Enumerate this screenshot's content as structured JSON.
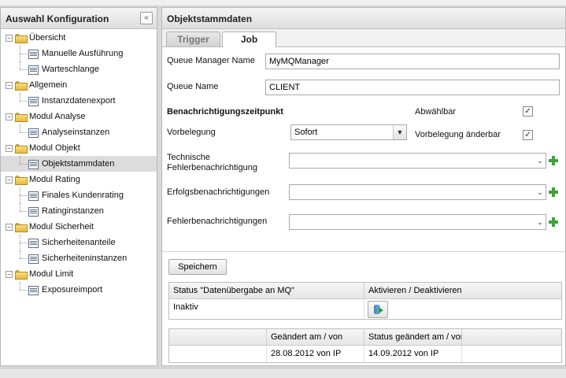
{
  "left_panel": {
    "title": "Auswahl Konfiguration",
    "collapse_glyph": "«",
    "tree": [
      {
        "label": "Übersicht",
        "type": "folder",
        "icon": "folder-icon"
      },
      {
        "label": "Manuelle Ausführung",
        "type": "item",
        "icon": "document-icon"
      },
      {
        "label": "Warteschlange",
        "type": "item",
        "icon": "document-icon"
      },
      {
        "label": "Allgemein",
        "type": "folder",
        "icon": "folder-icon"
      },
      {
        "label": "Instanzdatenexport",
        "type": "item",
        "icon": "document-icon"
      },
      {
        "label": "Modul Analyse",
        "type": "folder",
        "icon": "folder-icon"
      },
      {
        "label": "Analyseinstanzen",
        "type": "item",
        "icon": "document-icon"
      },
      {
        "label": "Modul Objekt",
        "type": "folder",
        "icon": "folder-icon"
      },
      {
        "label": "Objektstammdaten",
        "type": "item",
        "icon": "document-icon",
        "selected": true
      },
      {
        "label": "Modul Rating",
        "type": "folder",
        "icon": "folder-icon"
      },
      {
        "label": "Finales Kundenrating",
        "type": "item",
        "icon": "document-icon"
      },
      {
        "label": "Ratinginstanzen",
        "type": "item",
        "icon": "document-icon"
      },
      {
        "label": "Modul Sicherheit",
        "type": "folder",
        "icon": "folder-icon"
      },
      {
        "label": "Sicherheitenanteile",
        "type": "item",
        "icon": "document-icon"
      },
      {
        "label": "Sicherheiteninstanzen",
        "type": "item",
        "icon": "document-icon"
      },
      {
        "label": "Modul Limit",
        "type": "folder",
        "icon": "folder-icon"
      },
      {
        "label": "Exposureimport",
        "type": "item",
        "icon": "document-icon"
      }
    ]
  },
  "right_panel": {
    "title": "Objektstammdaten",
    "tabs": [
      {
        "label": "Trigger",
        "active": false
      },
      {
        "label": "Job",
        "active": true
      }
    ]
  },
  "form": {
    "queue_manager_label": "Queue Manager Name",
    "queue_manager_value": "MyMQManager",
    "queue_name_label": "Queue Name",
    "queue_name_value": "CLIENT",
    "section_title": "Benachrichtigungszeitpunkt",
    "abwaehlbar_label": "Abwählbar",
    "abwaehlbar_checked": true,
    "vorbelegung_label": "Vorbelegung",
    "vorbelegung_value": "Sofort",
    "vorbelegung_aenderbar_label": "Vorbelegung änderbar",
    "vorbelegung_aenderbar_checked": true,
    "tech_fehler_label_1": "Technische",
    "tech_fehler_label_2": "Fehlerbenachrichtigung",
    "erfolg_label": "Erfolgsbenachrichtigungen",
    "fehler_label": "Fehlerbenachrichtigungen",
    "check_glyph": "✓",
    "dropdown_glyph": "▼",
    "combo_glyph": "⌄"
  },
  "save_button": "Speichern",
  "status_table": {
    "headers": [
      "Status \"Datenübergabe an MQ\"",
      "Aktivieren / Deaktivieren"
    ],
    "status_value": "Inaktiv",
    "action_icon": "database-run-icon"
  },
  "history_table": {
    "headers": [
      "",
      "Geändert am / von",
      "Status geändert am / von",
      ""
    ],
    "row": [
      "",
      "28.08.2012 von IP",
      "14.09.2012 von IP",
      ""
    ]
  },
  "colors": {
    "folder": "#e8b93b",
    "plus": "#3ea33a",
    "selected_row": "#dcdcdc"
  }
}
